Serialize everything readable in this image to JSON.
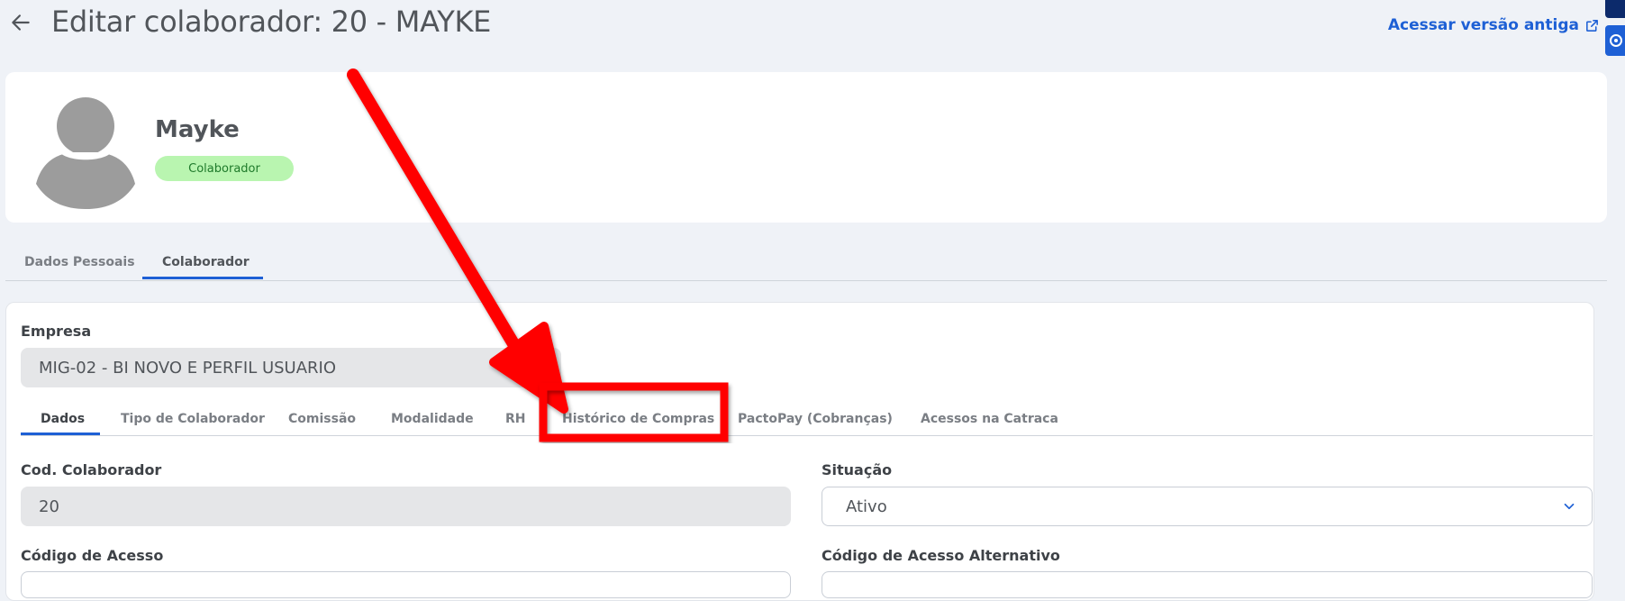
{
  "header": {
    "title": "Editar colaborador: 20 - MAYKE",
    "old_version_link": "Acessar versão antiga"
  },
  "profile": {
    "name": "Mayke",
    "badge": "Colaborador"
  },
  "top_tabs": [
    {
      "label": "Dados Pessoais",
      "active": false
    },
    {
      "label": "Colaborador",
      "active": true
    }
  ],
  "form": {
    "empresa_label": "Empresa",
    "empresa_value": "MIG-02 - BI NOVO E PERFIL USUARIO",
    "cod_label": "Cod. Colaborador",
    "cod_value": "20",
    "situacao_label": "Situação",
    "situacao_value": "Ativo",
    "acesso_label": "Código de Acesso",
    "acesso_alt_label": "Código de Acesso Alternativo"
  },
  "inner_tabs": [
    {
      "label": "Dados",
      "active": true
    },
    {
      "label": "Tipo de Colaborador",
      "active": false
    },
    {
      "label": "Comissão",
      "active": false
    },
    {
      "label": "Modalidade",
      "active": false
    },
    {
      "label": "RH",
      "active": false
    },
    {
      "label": "Histórico de Compras",
      "active": false,
      "highlighted": true
    },
    {
      "label": "PactoPay (Cobranças)",
      "active": false
    },
    {
      "label": "Acessos na Catraca",
      "active": false
    }
  ],
  "icons": {
    "back": "arrow-left-icon",
    "external": "external-link-icon",
    "dropdown": "chevron-down-icon",
    "avatar": "user-avatar-icon"
  },
  "colors": {
    "accent": "#1e60d5",
    "badge_bg": "#b9f5b0",
    "annotation": "#ff0000",
    "page_bg": "#eff2f7"
  }
}
